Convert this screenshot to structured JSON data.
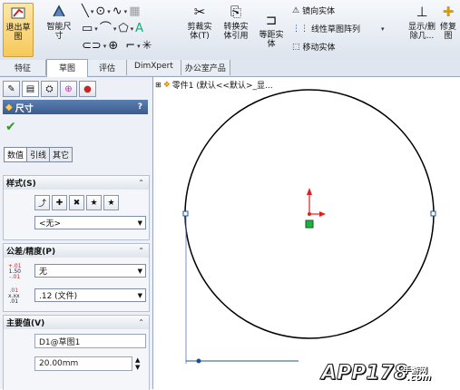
{
  "ribbon": {
    "exit_sketch": "退出草\n图",
    "smart_dim": "智能尺\n寸",
    "trim": "剪裁实\n体(T)",
    "convert": "转换实\n体引用",
    "offset": "等距实\n体",
    "mirror": "镜向实体",
    "linear_pattern": "线性草图阵列",
    "move": "移动实体",
    "show_hide": "显示/删\n除几...",
    "repair": "修复\n图"
  },
  "tabs": [
    "特征",
    "草图",
    "评估",
    "DimXpert",
    "办公室产品"
  ],
  "tree": {
    "label": "零件1 (默认<<默认>_显..."
  },
  "panel": {
    "title": "尺寸",
    "help": "?",
    "subtabs": [
      "数值",
      "引线",
      "其它"
    ],
    "style": {
      "header": "样式(S)",
      "value": "<无>"
    },
    "tolerance": {
      "header": "公差/精度(P)",
      "tol_value": "无",
      "prec_value": ".12 (文件)",
      "tol_icon_text": "1.50",
      "prec_icon_text": "x.xx"
    },
    "primary": {
      "header": "主要值(V)",
      "name": "D1@草图1",
      "value": "20.00mm"
    }
  },
  "watermark": {
    "main": "APP178",
    "cn": "手游网",
    "dot": ".com"
  },
  "colors": {
    "accent": "#3a5b8f",
    "ok": "#2c9a1a",
    "red": "#e02020"
  }
}
